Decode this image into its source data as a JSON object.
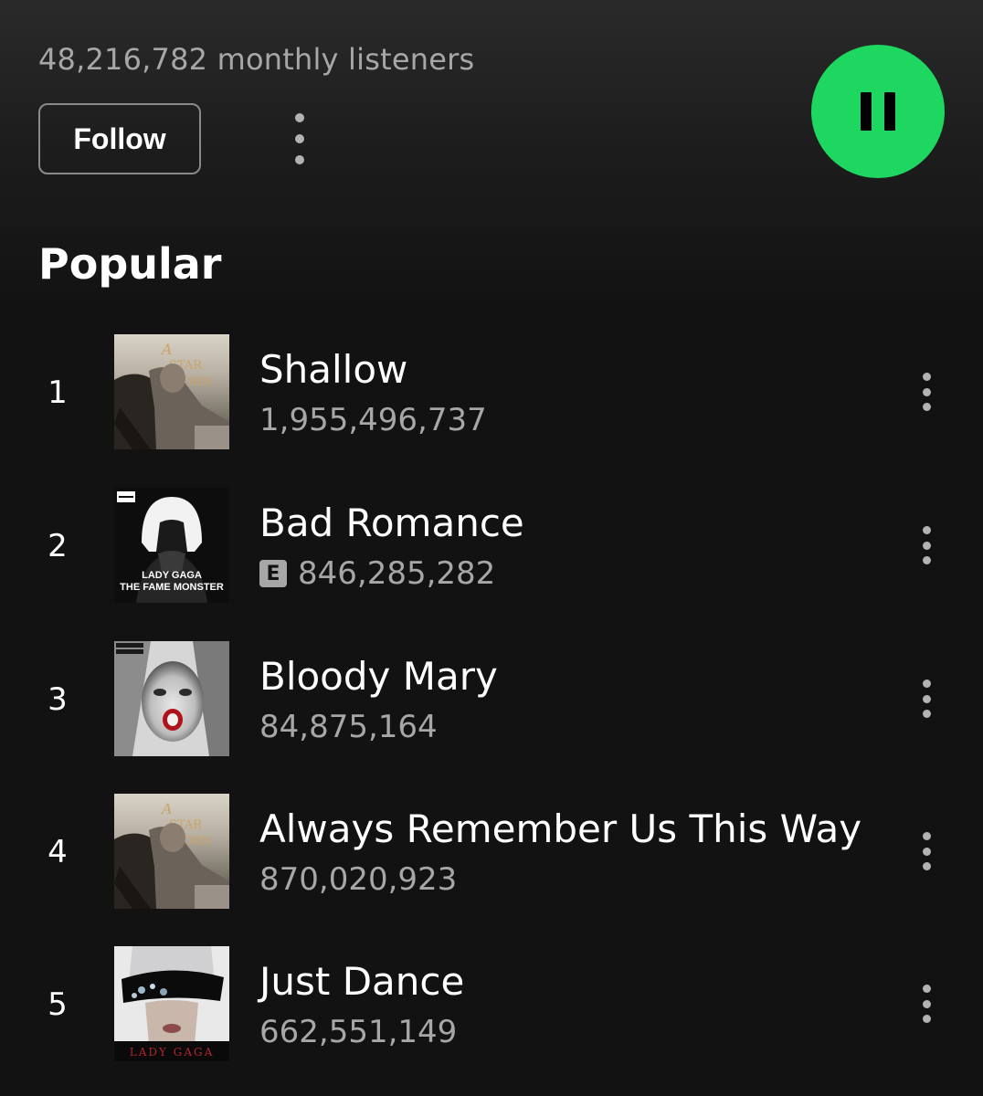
{
  "artist": {
    "monthly_listeners": "48,216,782 monthly listeners",
    "follow_label": "Follow"
  },
  "player": {
    "state": "playing",
    "accent": "#1ed760"
  },
  "popular": {
    "title": "Popular",
    "tracks": [
      {
        "rank": "1",
        "title": "Shallow",
        "plays": "1,955,496,737",
        "explicit": false,
        "cover": "a-star-is-born-cover"
      },
      {
        "rank": "2",
        "title": "Bad Romance",
        "plays": "846,285,282",
        "explicit": true,
        "explicit_label": "E",
        "cover": "the-fame-monster-cover",
        "cover_text": [
          "LADY GAGA",
          "THE FAME MONSTER"
        ]
      },
      {
        "rank": "3",
        "title": "Bloody Mary",
        "plays": "84,875,164",
        "explicit": false,
        "cover": "born-this-way-cover"
      },
      {
        "rank": "4",
        "title": "Always Remember Us This Way",
        "plays": "870,020,923",
        "explicit": false,
        "cover": "a-star-is-born-cover"
      },
      {
        "rank": "5",
        "title": "Just Dance",
        "plays": "662,551,149",
        "explicit": false,
        "cover": "the-fame-cover",
        "cover_text": [
          "LADY GAGA"
        ]
      }
    ]
  },
  "icons": {
    "more": "more-vertical-icon",
    "pause": "pause-icon",
    "explicit": "explicit-badge"
  },
  "colors": {
    "background": "#121212",
    "text_primary": "#ffffff",
    "text_secondary": "#a7a7a7",
    "accent": "#1ed760"
  }
}
